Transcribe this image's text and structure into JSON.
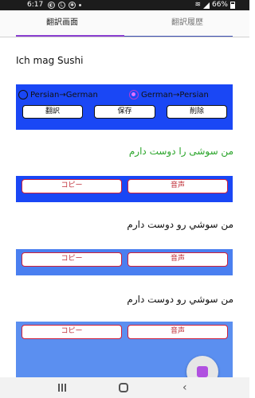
{
  "status_bar": {
    "time": "6:17",
    "battery": "66%"
  },
  "tabs": [
    {
      "label": "翻訳画面",
      "active": true
    },
    {
      "label": "翻訳履歴",
      "active": false
    }
  ],
  "input_text": "Ich mag Sushi",
  "direction_options": [
    {
      "label": "Persian→German",
      "checked": false
    },
    {
      "label": "German→Persian",
      "checked": true
    }
  ],
  "actions": {
    "translate": "翻訳",
    "save": "保存",
    "delete": "削除"
  },
  "results": [
    {
      "text": "من سوشی را دوست دارم",
      "copy_label": "コピー",
      "audio_label": "音声"
    },
    {
      "text": "من سوشي رو دوست دارم",
      "copy_label": "コピー",
      "audio_label": "音声"
    },
    {
      "text": "من سوشي رو دوست دارم",
      "copy_label": "コピー",
      "audio_label": "音声"
    }
  ],
  "colors": {
    "panel_blue": "#1a47f5",
    "accent_purple": "#8a3fd0",
    "result_green": "#2aa52a",
    "button_red": "#d0203a"
  }
}
